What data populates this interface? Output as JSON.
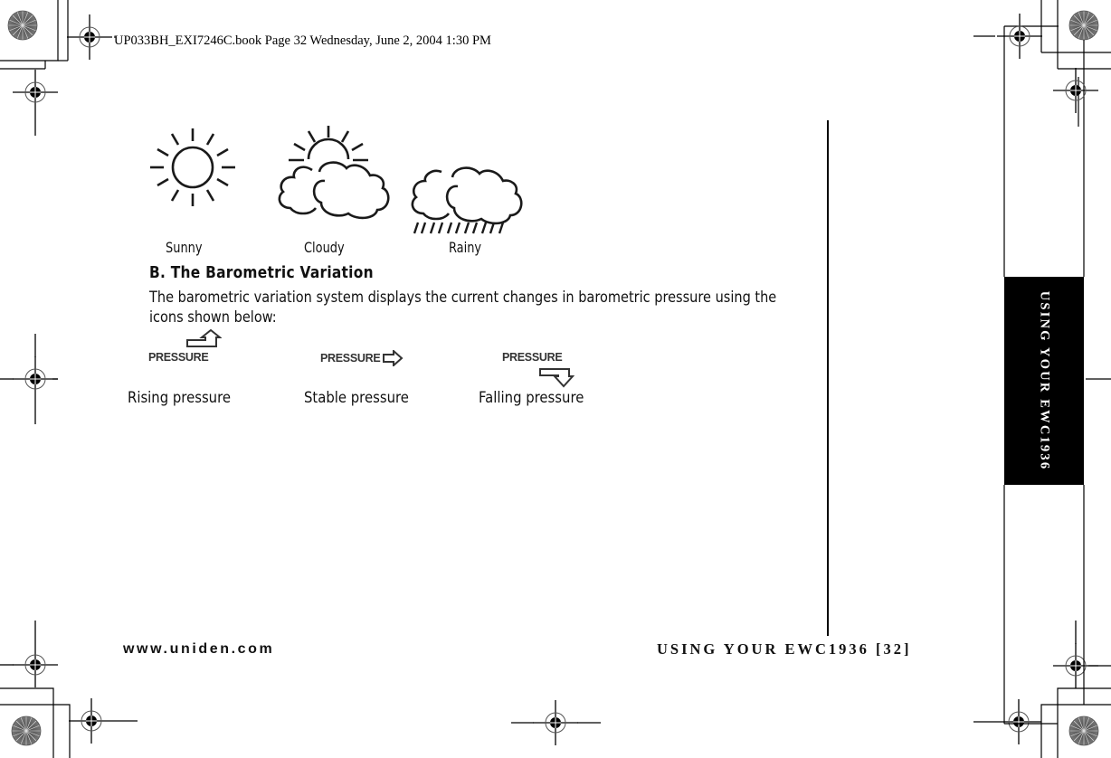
{
  "header": {
    "book_info": "UP033BH_EXI7246C.book  Page 32  Wednesday, June 2, 2004  1:30 PM"
  },
  "weather_icons": [
    {
      "icon": "sun-icon",
      "label": "Sunny"
    },
    {
      "icon": "sun-cloud-icon",
      "label": "Cloudy"
    },
    {
      "icon": "rain-cloud-icon",
      "label": "Rainy"
    }
  ],
  "section": {
    "title": "B. The Barometric Variation",
    "body": "The barometric variation system displays the current changes in barometric pressure using the icons shown below:"
  },
  "pressure_icons": [
    {
      "icon": "arrow-up-right-icon",
      "word": "PRESSURE",
      "label": "Rising pressure"
    },
    {
      "icon": "arrow-right-icon",
      "word": "PRESSURE",
      "label": "Stable pressure"
    },
    {
      "icon": "arrow-down-right-icon",
      "word": "PRESSURE",
      "label": "Falling pressure"
    }
  ],
  "side_tab": {
    "text": "USING YOUR EWC1936"
  },
  "footer": {
    "url": "www.uniden.com",
    "section_page": "USING YOUR EWC1936 [32]"
  },
  "colors": {
    "ink": "#000000",
    "tab_background": "#000000",
    "tab_text": "#ffffff"
  }
}
